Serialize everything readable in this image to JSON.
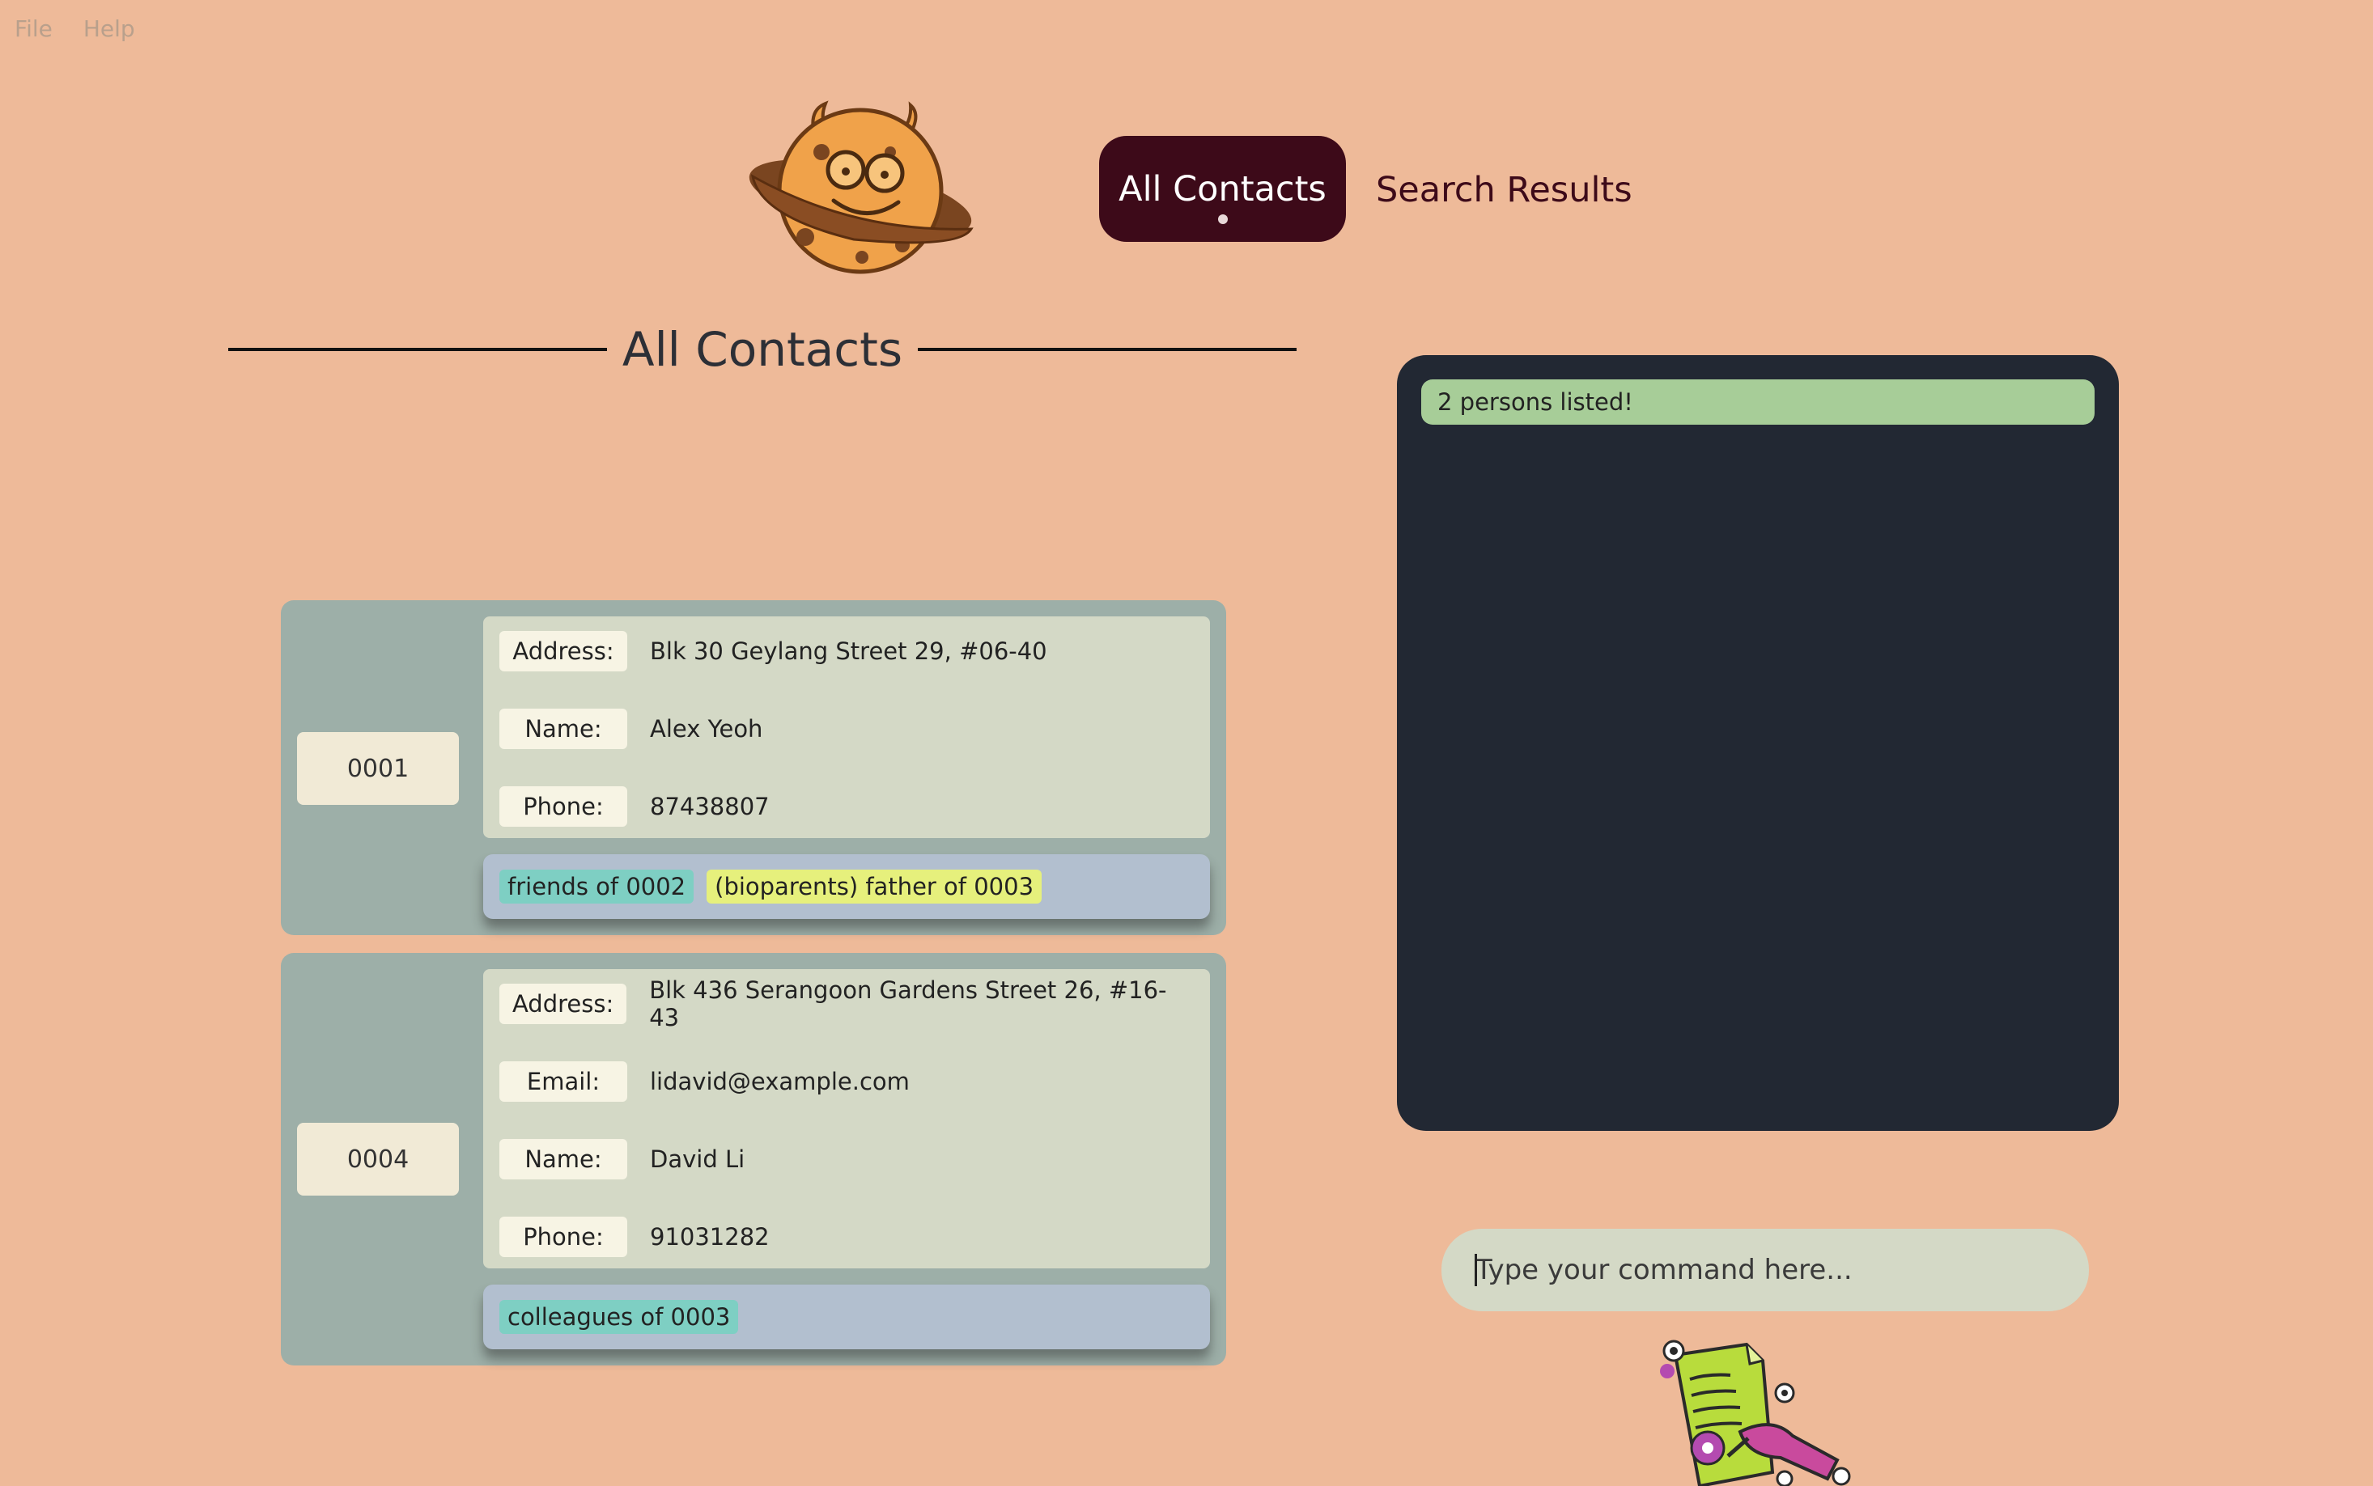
{
  "menu": {
    "items": [
      "File",
      "Help"
    ]
  },
  "nav": {
    "tabs": [
      {
        "label": "All Contacts",
        "active": true
      },
      {
        "label": "Search Results",
        "active": false
      }
    ]
  },
  "section_title": "All Contacts",
  "contacts": [
    {
      "id": "0001",
      "fields": [
        {
          "label": "Address:",
          "value": "Blk 30 Geylang Street 29, #06-40"
        },
        {
          "label": "Name:",
          "value": "Alex Yeoh"
        },
        {
          "label": "Phone:",
          "value": "87438807"
        }
      ],
      "tags": [
        "friends of 0002",
        "(bioparents) father of 0003"
      ]
    },
    {
      "id": "0004",
      "fields": [
        {
          "label": "Address:",
          "value": "Blk 436 Serangoon Gardens Street 26, #16-43"
        },
        {
          "label": "Email:",
          "value": "lidavid@example.com"
        },
        {
          "label": "Name:",
          "value": "David Li"
        },
        {
          "label": "Phone:",
          "value": "91031282"
        }
      ],
      "tags": [
        "colleagues of 0003"
      ]
    }
  ],
  "result": {
    "message": "2 persons listed!"
  },
  "command": {
    "placeholder": "Type your command here...",
    "value": ""
  },
  "colors": {
    "background": "#EEBA99",
    "tab_active": "#3D0A19",
    "result_panel": "#222833",
    "success_badge": "#A7CD98",
    "card": "#9DAFA8",
    "tag_teal": "#7ECFC3",
    "tag_yellow": "#E6F07C"
  }
}
